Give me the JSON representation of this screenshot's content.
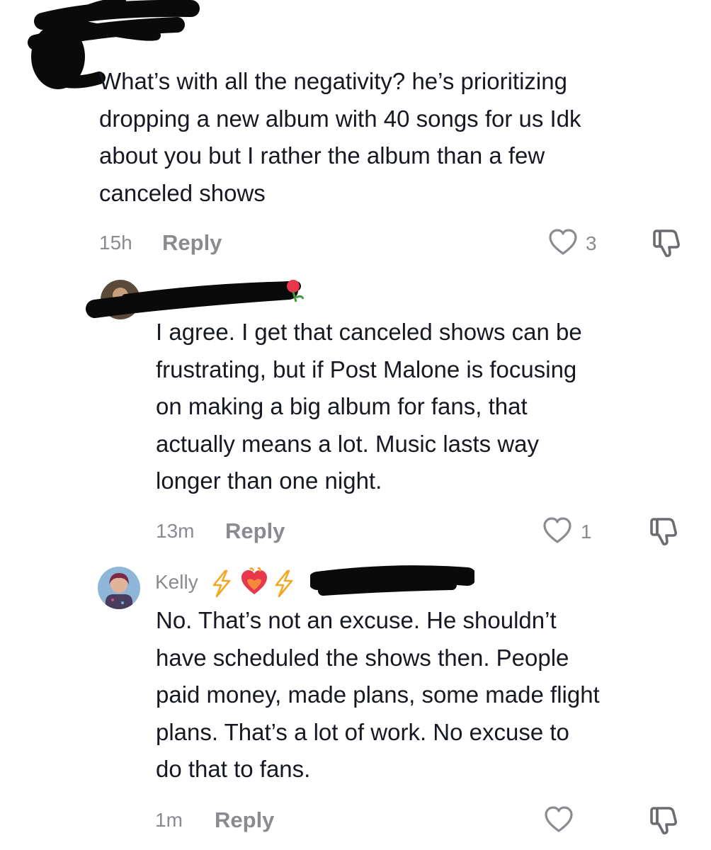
{
  "comments": [
    {
      "text": "What’s with all the negativity? he’s prioritizing\ndropping a new album with 40 songs for us Idk\nabout you but I rather the album than a few\ncanceled shows",
      "time": "15h",
      "reply_label": "Reply",
      "likes": "3"
    },
    {
      "text": "I agree. I get that canceled shows can be\nfrustrating, but if Post Malone is focusing\non making a big album for fans, that\nactually means a lot. Music lasts way\nlonger than one night.",
      "time": "13m",
      "reply_label": "Reply",
      "likes": "1"
    },
    {
      "username": "Kelly",
      "badges": [
        "lightning-emoji",
        "heart-on-fire-emoji",
        "lightning-emoji"
      ],
      "text": "No. That’s not an excuse. He shouldn’t\nhave scheduled the shows then. People\npaid money, made plans, some made flight\nplans. That’s a lot of work. No excuse to\ndo that to fans.",
      "time": "1m",
      "reply_label": "Reply",
      "likes": ""
    }
  ],
  "colors": {
    "text": "#161823",
    "muted": "#8a8b91",
    "redaction": "#0a0a0a",
    "lightning": "#f5a623",
    "fire": "#e8374a"
  }
}
